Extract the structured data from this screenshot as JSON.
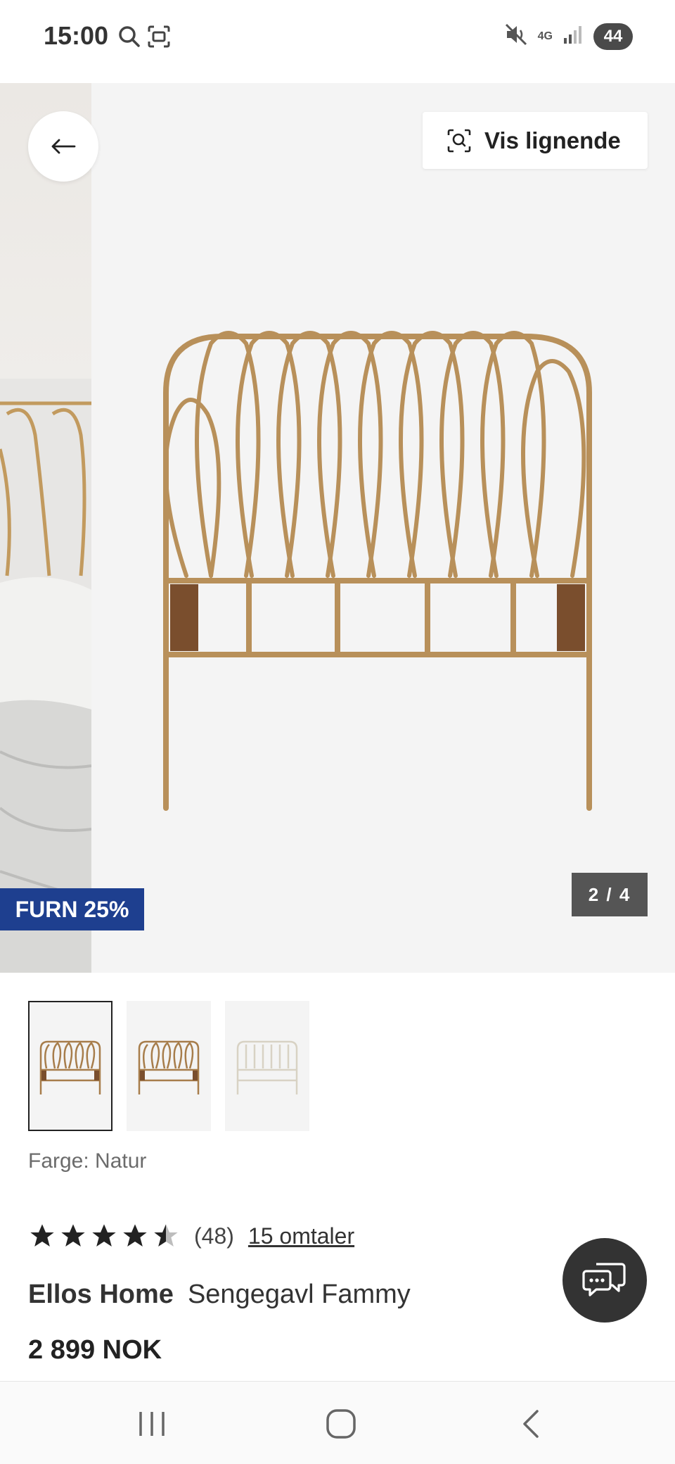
{
  "status_bar": {
    "time": "15:00",
    "network": "4G",
    "battery": "44"
  },
  "gallery": {
    "similar_label": "Vis lignende",
    "promo": "FURN 25%",
    "page_indicator": "2 / 4"
  },
  "product": {
    "color_label": "Farge: Natur",
    "rating": 4.5,
    "rating_count": "(48)",
    "reviews_link": "15 omtaler",
    "brand": "Ellos Home",
    "name": "Sengegavl Fammy",
    "price": "2 899 NOK"
  },
  "colors": {
    "promo_bg": "#1e3f8f",
    "rattan": "#b8905a",
    "chat_bg": "#333333"
  }
}
